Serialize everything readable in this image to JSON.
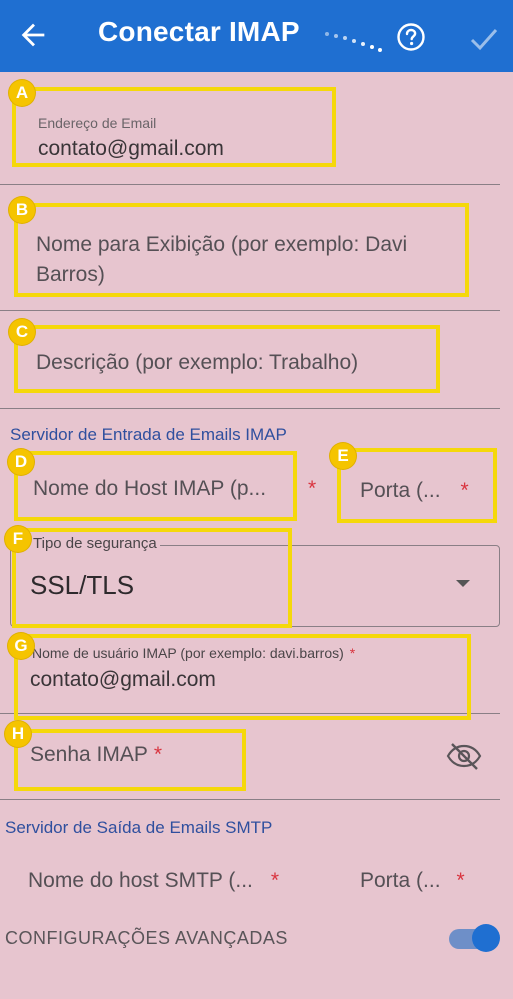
{
  "appbar": {
    "title": "Conectar IMAP"
  },
  "fields": {
    "email": {
      "label": "Endereço de Email",
      "value": "contato@gmail.com"
    },
    "display_name": {
      "hint": "Nome para Exibição (por exemplo: Davi Barros)"
    },
    "description": {
      "hint": "Descrição (por exemplo: Trabalho)"
    },
    "imap_host": {
      "hint": "Nome do Host IMAP (p...",
      "required": "*"
    },
    "imap_port": {
      "hint": "Porta (...",
      "required": "*"
    },
    "security": {
      "label": "Tipo de segurança",
      "value": "SSL/TLS"
    },
    "imap_user": {
      "label": "Nome de usuário IMAP (por exemplo: davi.barros)",
      "required": "*",
      "value": "contato@gmail.com"
    },
    "imap_password": {
      "hint": "Senha IMAP",
      "required": "*"
    },
    "smtp_host": {
      "hint": "Nome do host SMTP (...",
      "required": "*"
    },
    "smtp_port": {
      "hint": "Porta (...",
      "required": "*"
    }
  },
  "sections": {
    "incoming": "Servidor de Entrada de Emails IMAP",
    "outgoing": "Servidor de Saída de Emails SMTP"
  },
  "advanced": {
    "label": "CONFIGURAÇÕES AVANÇADAS",
    "enabled": true
  },
  "markers": {
    "a": "A",
    "b": "B",
    "c": "C",
    "d": "D",
    "e": "E",
    "f": "F",
    "g": "G",
    "h": "H"
  },
  "colors": {
    "appbar": "#1f6fd1",
    "background": "#e7c5cf",
    "marker": "#f5d80a",
    "required": "#d9343f",
    "section": "#2f4f9e"
  },
  "icons": {
    "back": "arrow-left-icon",
    "help": "help-circle-icon",
    "confirm": "check-icon",
    "password_visibility": "eye-off-icon",
    "dropdown": "caret-down-icon"
  }
}
